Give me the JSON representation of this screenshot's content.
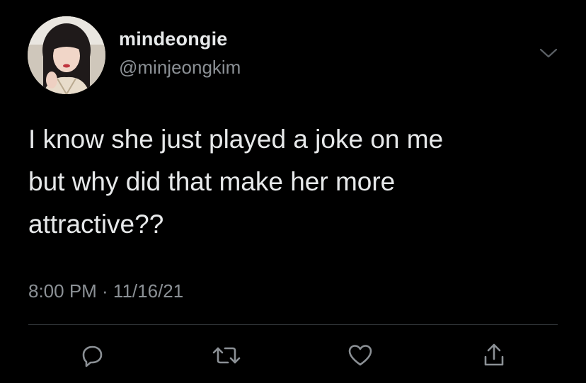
{
  "user": {
    "display_name": "mindeongie",
    "handle": "@minjeongkim"
  },
  "tweet": {
    "lines": [
      "I know she just played a joke on me",
      "but why did that make her more",
      "attractive??"
    ],
    "timestamp": "8:00 PM · 11/16/21"
  },
  "icons": {
    "menu": "chevron-down-icon",
    "reply": "reply-icon",
    "retweet": "retweet-icon",
    "like": "heart-icon",
    "share": "share-icon"
  },
  "colors": {
    "background": "#000000",
    "text_primary": "#e7e9ea",
    "text_secondary": "#8b9095",
    "divider": "#2f3336"
  }
}
